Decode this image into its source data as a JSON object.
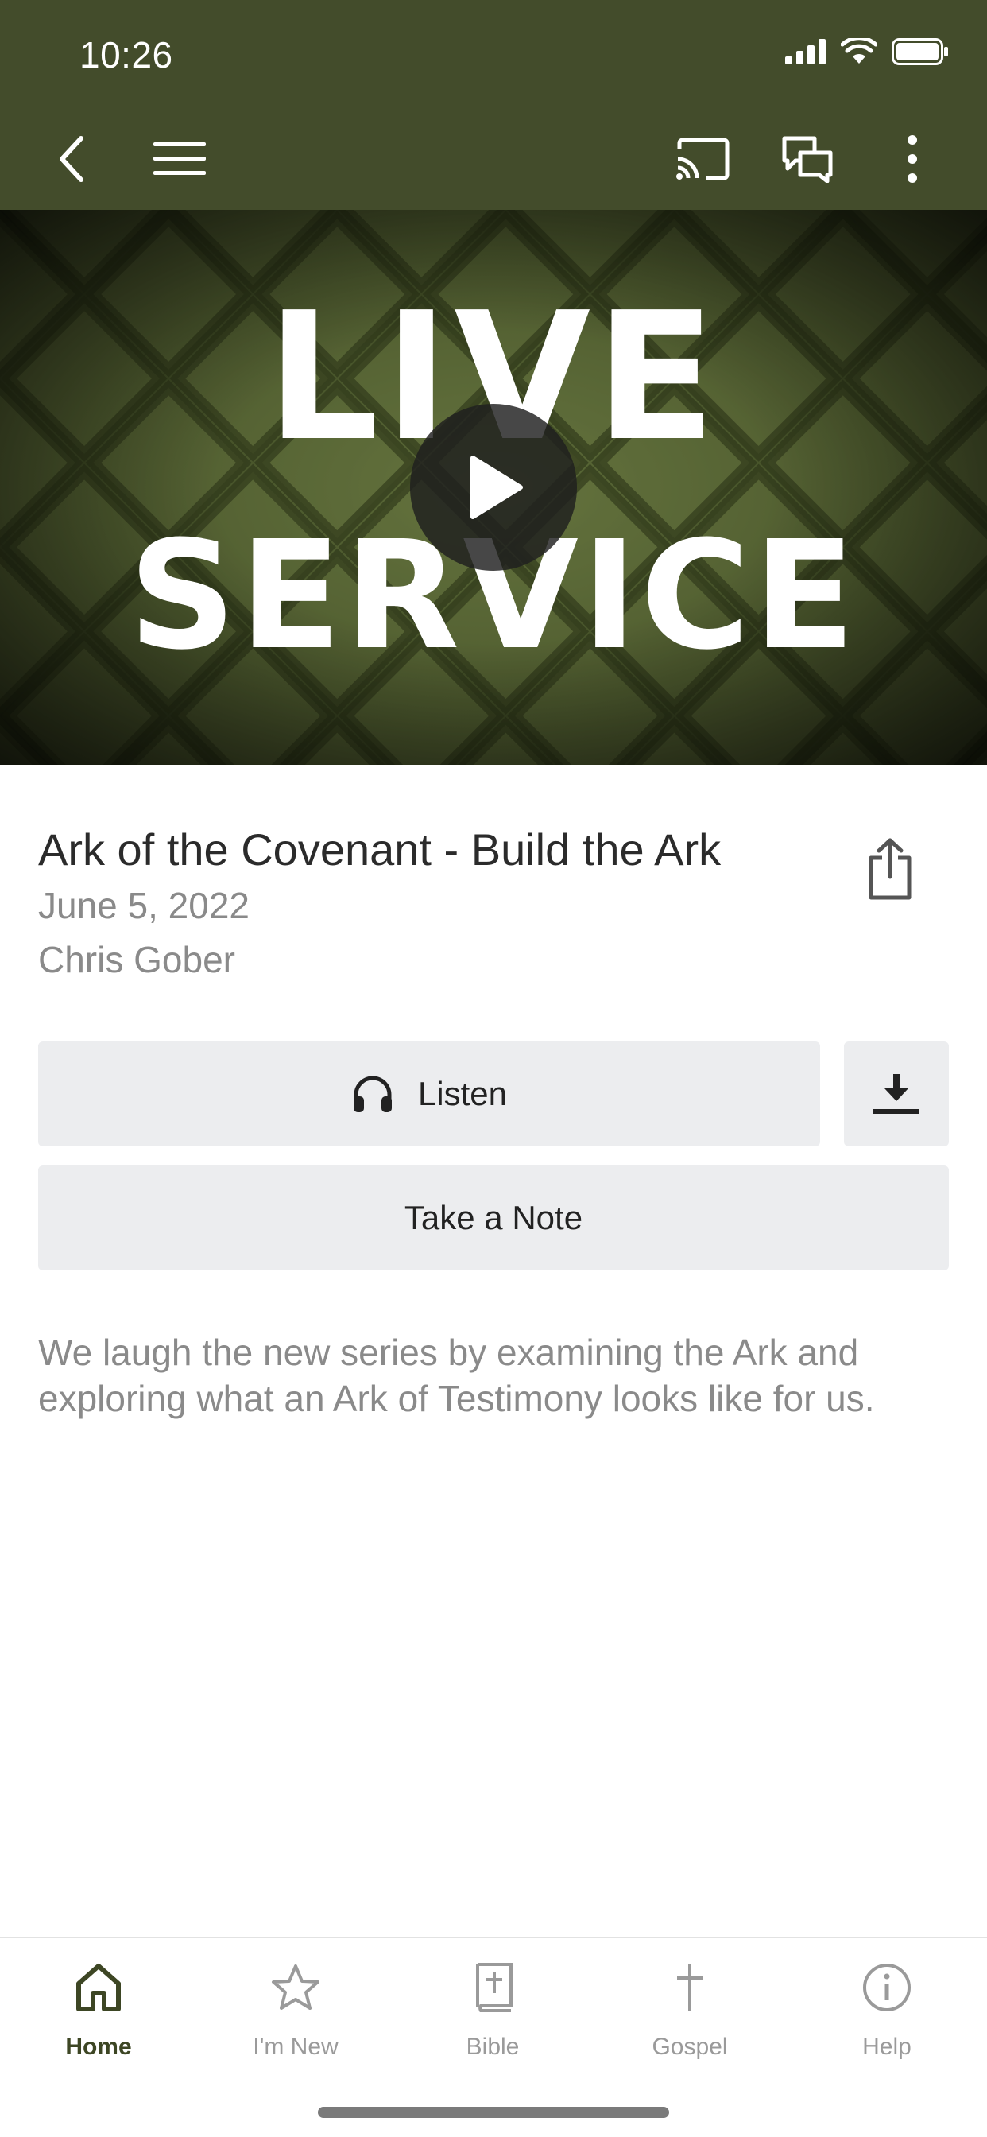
{
  "status_bar": {
    "time": "10:26"
  },
  "hero": {
    "line1": "LIVE",
    "line2": "SERVICE"
  },
  "sermon": {
    "title": "Ark of the Covenant - Build the Ark",
    "date": "June 5, 2022",
    "speaker": "Chris Gober",
    "description": "We laugh the new series by examining the Ark and exploring what an Ark of Testimony looks like for us."
  },
  "actions": {
    "listen_label": "Listen",
    "take_note_label": "Take a Note"
  },
  "tabs": [
    {
      "label": "Home",
      "icon": "home-icon",
      "active": true
    },
    {
      "label": "I'm New",
      "icon": "star-icon",
      "active": false
    },
    {
      "label": "Bible",
      "icon": "bible-icon",
      "active": false
    },
    {
      "label": "Gospel",
      "icon": "cross-icon",
      "active": false
    },
    {
      "label": "Help",
      "icon": "info-icon",
      "active": false
    }
  ],
  "colors": {
    "brand": "#434c2b",
    "active_tab": "#3d4624",
    "button_bg": "#ecedef"
  }
}
